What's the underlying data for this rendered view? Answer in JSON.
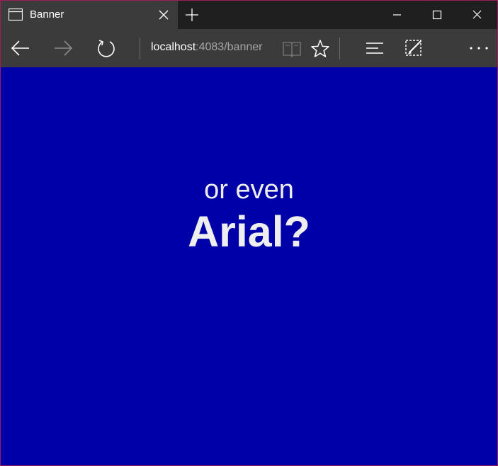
{
  "browser": {
    "tab": {
      "title": "Banner",
      "icon": "page-icon"
    },
    "controls": {
      "new_tab_icon": "plus-icon",
      "minimize_icon": "minimize-icon",
      "maximize_icon": "maximize-icon",
      "close_icon": "close-icon"
    },
    "address_bar": {
      "host": "localhost",
      "rest": ":4083/banner"
    },
    "toolbar_icons": [
      "back-arrow-icon",
      "forward-arrow-icon",
      "refresh-icon",
      "reading-view-icon",
      "star-icon",
      "hub-icon",
      "web-note-icon",
      "more-icon"
    ]
  },
  "page": {
    "background_color": "#0000a8",
    "text_color": "#eeeeee",
    "line1": "or even",
    "line2": "Arial?"
  }
}
